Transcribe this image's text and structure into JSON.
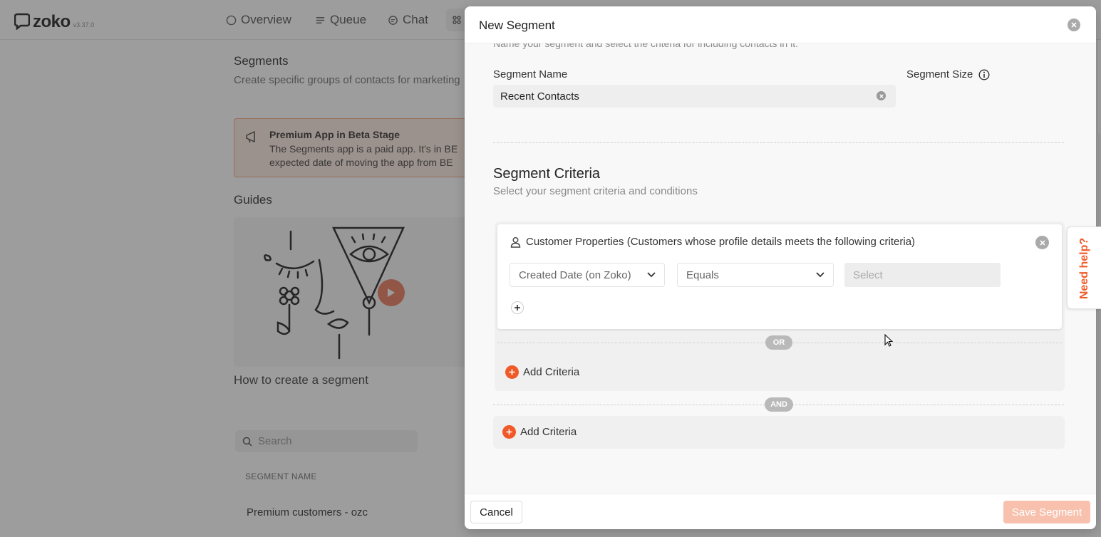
{
  "app": {
    "logo_text": "zoko",
    "version": "v3.37.0",
    "nav": [
      {
        "label": "Overview",
        "icon": "circle-icon"
      },
      {
        "label": "Queue",
        "icon": "list-icon"
      },
      {
        "label": "Chat",
        "icon": "chat-icon"
      }
    ]
  },
  "background": {
    "page_title": "Segments",
    "page_subtitle": "Create specific groups of contacts for marketing",
    "beta_title": "Premium App in Beta Stage",
    "beta_line1": "The Segments app is a paid app. It's in BE",
    "beta_line2": "expected date of moving the app from BE",
    "guides_title": "Guides",
    "guide_caption": "How to create a segment",
    "search_placeholder": "Search",
    "column_header": "SEGMENT NAME",
    "rows": [
      "Premium customers - ozc"
    ]
  },
  "modal": {
    "title": "New Segment",
    "intro_cut": "Name your segment and select the criteria for including contacts in it.",
    "segment_name_label": "Segment Name",
    "segment_name_value": "Recent Contacts",
    "segment_size_label": "Segment Size",
    "criteria_title": "Segment Criteria",
    "criteria_subtitle": "Select your segment criteria and conditions",
    "criteria_card": {
      "title": "Customer Properties (Customers whose profile details meets the following criteria)",
      "field_select": "Created Date (on Zoko)",
      "operator_select": "Equals",
      "value_placeholder": "Select"
    },
    "or_label": "OR",
    "and_label": "AND",
    "add_criteria_label": "Add Criteria",
    "add_criteria_label_2": "Add Criteria",
    "cancel_label": "Cancel",
    "save_label": "Save Segment"
  },
  "help": {
    "label": "Need help?"
  },
  "colors": {
    "accent": "#f05a28",
    "beta_bg": "#fde8de",
    "overlay": "rgba(60,60,60,0.5)"
  }
}
